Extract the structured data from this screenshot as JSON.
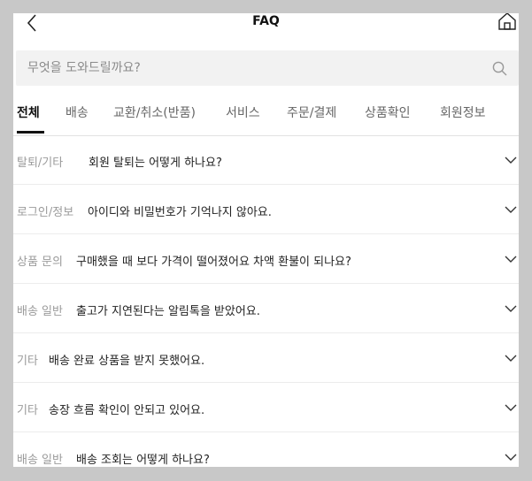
{
  "header": {
    "title": "FAQ",
    "back_icon": "chevron-left-icon",
    "home_icon": "home-icon"
  },
  "search": {
    "placeholder": "무엇을 도와드릴까요?",
    "value": "",
    "icon": "search-icon"
  },
  "tabs": [
    {
      "label": "전체",
      "active": true
    },
    {
      "label": "배송",
      "active": false
    },
    {
      "label": "교환/취소(반품)",
      "active": false
    },
    {
      "label": "서비스",
      "active": false
    },
    {
      "label": "주문/결제",
      "active": false
    },
    {
      "label": "상품확인",
      "active": false
    },
    {
      "label": "회원정보",
      "active": false
    }
  ],
  "faq": [
    {
      "category": "탈퇴/기타",
      "question": "회원 탈퇴는 어떻게 하나요?"
    },
    {
      "category": "로그인/정보",
      "question": "아이디와 비밀번호가 기억나지 않아요."
    },
    {
      "category": "상품 문의",
      "question": "구매했을 때 보다 가격이 떨어졌어요 차액 환불이 되나요?"
    },
    {
      "category": "배송 일반",
      "question": "출고가 지연된다는 알림톡을 받았어요."
    },
    {
      "category": "기타",
      "question": "배송 완료 상품을 받지 못했어요."
    },
    {
      "category": "기타",
      "question": "송장 흐름 확인이 안되고 있어요."
    },
    {
      "category": "배송 일반",
      "question": "배송 조회는 어떻게 하나요?"
    }
  ],
  "colors": {
    "accent": "#111111",
    "muted": "#9a9a9a",
    "search_bg": "#f2f2f2"
  }
}
